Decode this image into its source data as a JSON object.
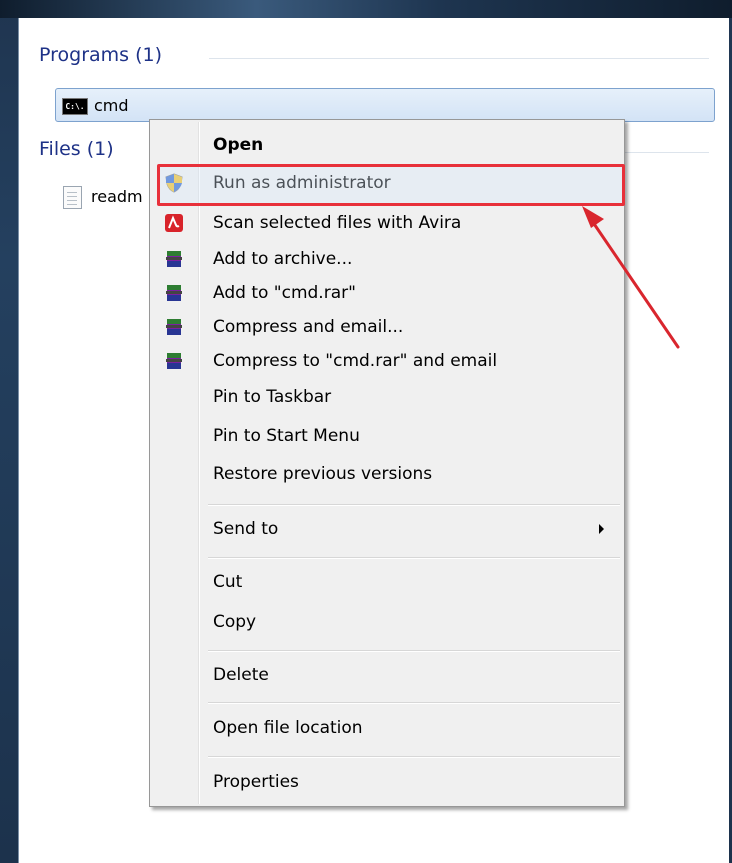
{
  "results": {
    "programs_header": "Programs (1)",
    "program_item": {
      "label": "cmd",
      "icon_text": "C:\\."
    },
    "files_header": "Files (1)",
    "file_item": {
      "label": "readm"
    }
  },
  "context_menu": {
    "items": [
      {
        "label": "Open",
        "icon": "none"
      },
      {
        "label": "Run as administrator",
        "icon": "uac-shield-icon"
      },
      {
        "label": "Scan selected files with Avira",
        "icon": "avira-icon"
      },
      {
        "label": "Add to archive...",
        "icon": "winrar-icon"
      },
      {
        "label": "Add to \"cmd.rar\"",
        "icon": "winrar-icon"
      },
      {
        "label": "Compress and email...",
        "icon": "winrar-icon"
      },
      {
        "label": "Compress to \"cmd.rar\" and email",
        "icon": "winrar-icon"
      },
      {
        "label": "Pin to Taskbar",
        "icon": "none"
      },
      {
        "label": "Pin to Start Menu",
        "icon": "none"
      },
      {
        "label": "Restore previous versions",
        "icon": "none"
      },
      {
        "label": "Send to",
        "icon": "none",
        "submenu": true
      },
      {
        "label": "Cut",
        "icon": "none"
      },
      {
        "label": "Copy",
        "icon": "none"
      },
      {
        "label": "Delete",
        "icon": "none"
      },
      {
        "label": "Open file location",
        "icon": "none"
      },
      {
        "label": "Properties",
        "icon": "none"
      }
    ]
  },
  "colors": {
    "highlight_border": "#e8303a",
    "annotation_arrow": "#d9262e",
    "selection_fill": "#d3e3f6",
    "header_text": "#1e3287"
  }
}
